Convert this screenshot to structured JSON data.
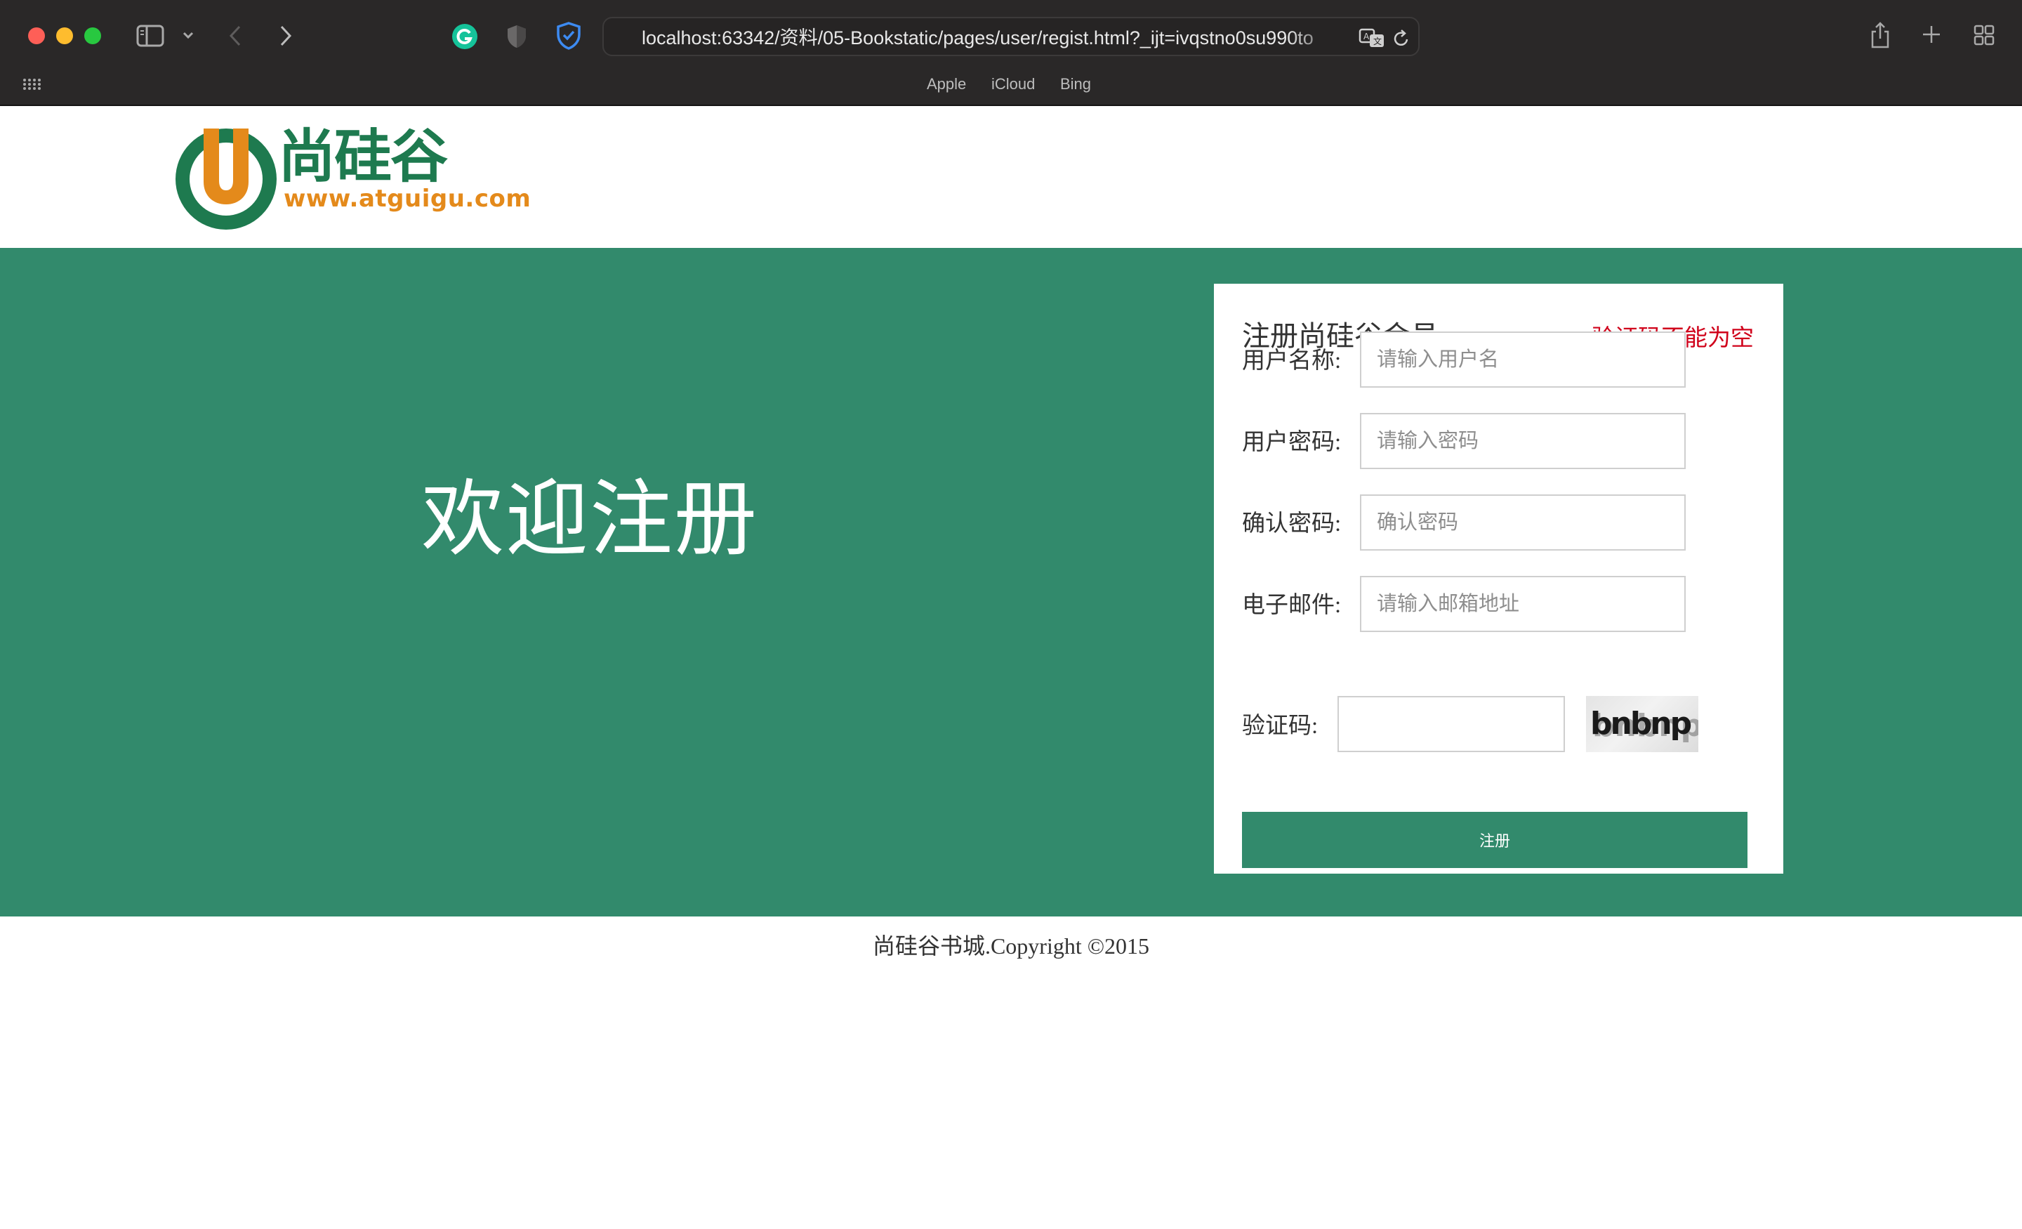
{
  "browser": {
    "url": "localhost:63342/资料/05-Bookstatic/pages/user/regist.html?_ijt=ivqstno0su990to",
    "favorites": [
      "Apple",
      "iCloud",
      "Bing"
    ],
    "colors": {
      "toolbar": "#2a2828",
      "close": "#fe5f57",
      "minimize": "#febc2e",
      "maximize": "#28c840"
    }
  },
  "header": {
    "logo_text": "尚硅谷",
    "logo_letter": "U",
    "logo_site": "www.atguigu.com",
    "colors": {
      "logo_green": "#1e7a4f",
      "logo_orange": "#e48a1b"
    }
  },
  "banner": {
    "welcome": "欢迎注册",
    "color": "#328a6c"
  },
  "form": {
    "title": "注册尚硅谷会员",
    "error_message": "验证码不能为空",
    "fields": {
      "username": {
        "label": "用户名称:",
        "placeholder": "请输入用户名",
        "value": ""
      },
      "password": {
        "label": "用户密码:",
        "placeholder": "请输入密码",
        "value": ""
      },
      "confirm": {
        "label": "确认密码:",
        "placeholder": "确认密码",
        "value": ""
      },
      "email": {
        "label": "电子邮件:",
        "placeholder": "请输入邮箱地址",
        "value": ""
      },
      "code": {
        "label": "验证码:",
        "placeholder": "",
        "value": ""
      }
    },
    "captcha_text": "bnbnp",
    "submit_label": "注册",
    "error_color": "#d0021b"
  },
  "footer": {
    "text": "尚硅谷书城.Copyright ©2015"
  }
}
